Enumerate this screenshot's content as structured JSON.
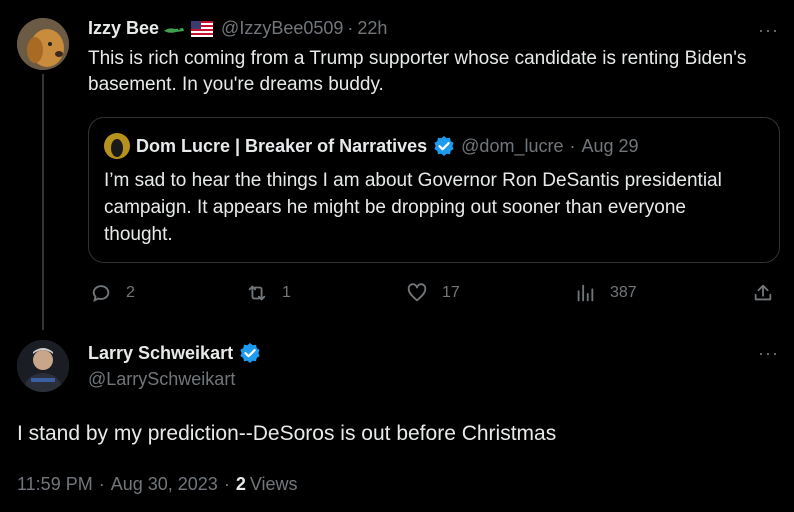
{
  "reply_tweet": {
    "display_name": "Izzy Bee",
    "handle": "@IzzyBee0509",
    "separator": "·",
    "time": "22h",
    "text": "This is rich coming from a Trump supporter whose candidate is renting Biden's basement. In you're dreams buddy.",
    "quote": {
      "display_name": "Dom Lucre | Breaker of Narratives",
      "handle": "@dom_lucre",
      "separator": "·",
      "date": "Aug 29",
      "text": "I’m sad to hear the things I am about Governor Ron DeSantis presidential campaign. It appears he might be dropping out sooner than everyone thought."
    },
    "stats": {
      "replies": "2",
      "retweets": "1",
      "likes": "17",
      "views": "387"
    }
  },
  "main_tweet": {
    "display_name": "Larry Schweikart",
    "handle": "@LarrySchweikart",
    "text": "I stand by my prediction--DeSoros is out before Christmas",
    "time": "11:59 PM",
    "separator1": "·",
    "date": "Aug 30, 2023",
    "separator2": "·",
    "views_count": "2",
    "views_label": "Views"
  },
  "more_label": "···",
  "colors": {
    "background": "#000000",
    "text": "#e7e9ea",
    "muted": "#71767b",
    "verified": "#1d9bf0",
    "border": "#2f3336"
  }
}
